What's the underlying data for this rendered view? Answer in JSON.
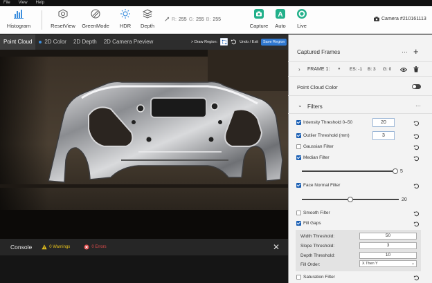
{
  "menu": [
    "File",
    "View",
    "Help"
  ],
  "toolbar": {
    "histogram": "Histogram",
    "resetview": "ResetView",
    "greenmode": "GreenMode",
    "hdr": "HDR",
    "depth": "Depth",
    "capture": "Capture",
    "auto": "Auto",
    "live": "Live",
    "rgb": {
      "r_label": "R:",
      "r": "255",
      "g_label": "G:",
      "g": "255",
      "b_label": "B:",
      "b": "255"
    },
    "camera": "Camera #210161113"
  },
  "tabs": {
    "point_cloud": "Point Cloud",
    "color_2d": "2D Color",
    "depth_2d": "2D Depth",
    "camera_preview": "2D Camera Preview",
    "draw_region": "> Draw Region:",
    "undo_exit": "Undo / Exit",
    "save_region": "Save Region"
  },
  "console": {
    "title": "Console",
    "warnings": "0 Warnings",
    "errors": "0 Errors"
  },
  "panel": {
    "captured_frames": "Captured Frames",
    "more": "···",
    "add": "+",
    "frame": {
      "label": "FRAME 1:",
      "es": "ES: -1",
      "b": "B: 3",
      "g": "G: 0"
    },
    "point_cloud_color": "Point Cloud Color",
    "filters_title": "Filters",
    "filters": {
      "intensity": {
        "label": "Intensity Threshold  0–50",
        "value": "20",
        "checked": true
      },
      "outlier": {
        "label": "Outlier Threshold (mm)",
        "value": "3",
        "checked": true
      },
      "gaussian": {
        "label": "Gaussian Filter",
        "checked": false
      },
      "median": {
        "label": "Median Filter",
        "checked": true,
        "slider_value": "5",
        "slider_fraction": 1.0
      },
      "face_normal": {
        "label": "Face Normal Filter",
        "checked": true,
        "slider_value": "20",
        "slider_fraction": 0.5
      },
      "smooth": {
        "label": "Smooth Filter",
        "checked": false
      },
      "fill_gaps": {
        "label": "Fill Gaps",
        "checked": true
      },
      "saturation": {
        "label": "Saturation Filter",
        "checked": false
      }
    },
    "fill_gaps": {
      "width_label": "Width Threshold:",
      "width": "50",
      "slope_label": "Slope Threshold:",
      "slope": "3",
      "depth_label": "Depth Threshold:",
      "depth": "10",
      "order_label": "Fill Order:",
      "order": "X Then Y"
    }
  }
}
